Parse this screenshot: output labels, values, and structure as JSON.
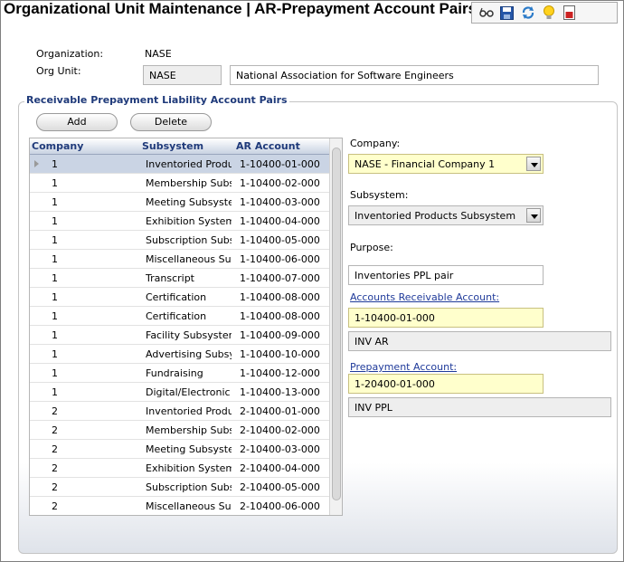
{
  "window": {
    "title": "Organizational Unit Maintenance | AR-Prepayment Account Pairs"
  },
  "toolbar": {
    "icons": [
      "glasses-icon",
      "save-icon",
      "refresh-icon",
      "lightbulb-icon",
      "report-icon"
    ]
  },
  "header": {
    "organization_label": "Organization:",
    "organization_value": "NASE",
    "org_unit_label": "Org Unit:",
    "org_unit_code": "NASE",
    "org_unit_name": "National Association for Software Engineers"
  },
  "group": {
    "title": "Receivable Prepayment Liability Account Pairs",
    "add_label": "Add",
    "delete_label": "Delete"
  },
  "grid": {
    "columns": [
      "Company",
      "Subsystem",
      "AR Account"
    ],
    "rows": [
      [
        "1",
        "Inventoried Produc",
        "1-10400-01-000"
      ],
      [
        "1",
        "Membership Subsy",
        "1-10400-02-000"
      ],
      [
        "1",
        "Meeting Subsystem",
        "1-10400-03-000"
      ],
      [
        "1",
        "Exhibition System",
        "1-10400-04-000"
      ],
      [
        "1",
        "Subscription Subsy",
        "1-10400-05-000"
      ],
      [
        "1",
        "Miscellaneous Subs",
        "1-10400-06-000"
      ],
      [
        "1",
        "Transcript",
        "1-10400-07-000"
      ],
      [
        "1",
        "Certification",
        "1-10400-08-000"
      ],
      [
        "1",
        "Certification",
        "1-10400-08-000"
      ],
      [
        "1",
        "Facility Subsystem",
        "1-10400-09-000"
      ],
      [
        "1",
        "Advertising Subsyst",
        "1-10400-10-000"
      ],
      [
        "1",
        "Fundraising",
        "1-10400-12-000"
      ],
      [
        "1",
        "Digital/Electronic C",
        "1-10400-13-000"
      ],
      [
        "2",
        "Inventoried Produc",
        "2-10400-01-000"
      ],
      [
        "2",
        "Membership Subsy",
        "2-10400-02-000"
      ],
      [
        "2",
        "Meeting Subsystem",
        "2-10400-03-000"
      ],
      [
        "2",
        "Exhibition System",
        "2-10400-04-000"
      ],
      [
        "2",
        "Subscription Subsy",
        "2-10400-05-000"
      ],
      [
        "2",
        "Miscellaneous Subs",
        "2-10400-06-000"
      ]
    ]
  },
  "detail": {
    "company_label": "Company:",
    "company_value": "NASE - Financial Company 1",
    "subsystem_label": "Subsystem:",
    "subsystem_value": "Inventoried Products Subsystem",
    "purpose_label": "Purpose:",
    "purpose_value": "Inventories PPL pair",
    "ar_account_label": "Accounts Receivable Account:",
    "ar_account_value": "1-10400-01-000",
    "ar_account_desc": "INV AR",
    "prepay_account_label": "Prepayment Account:",
    "prepay_account_value": "1-20400-01-000",
    "prepay_account_desc": "INV PPL"
  },
  "colors": {
    "accent": "#1f3a7a",
    "required_field": "#ffffcc",
    "selected_row": "#cad4e4"
  }
}
